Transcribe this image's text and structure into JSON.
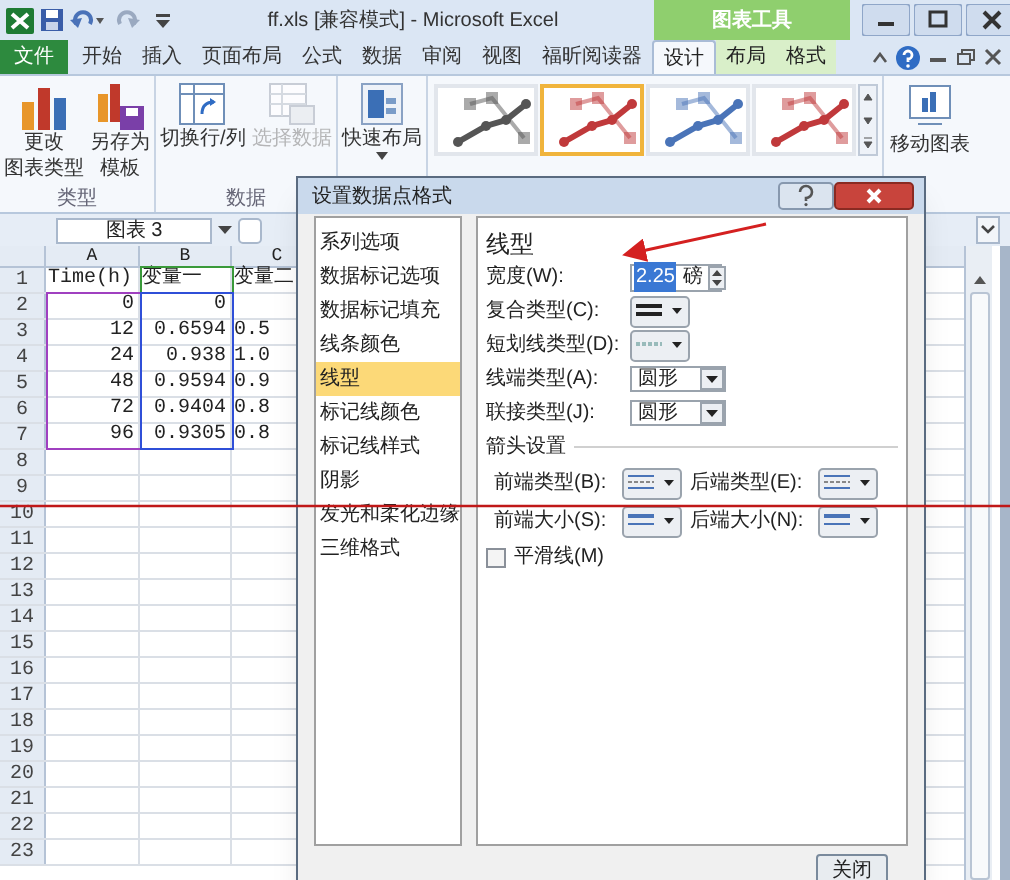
{
  "window": {
    "title": "ff.xls [兼容模式] - Microsoft Excel",
    "context_title": "图表工具"
  },
  "tabs": [
    {
      "label": "文件",
      "kind": "file",
      "selected": false
    },
    {
      "label": "开始",
      "kind": "tab",
      "selected": false
    },
    {
      "label": "插入",
      "kind": "tab",
      "selected": false
    },
    {
      "label": "页面布局",
      "kind": "tab",
      "selected": false
    },
    {
      "label": "公式",
      "kind": "tab",
      "selected": false
    },
    {
      "label": "数据",
      "kind": "tab",
      "selected": false
    },
    {
      "label": "审阅",
      "kind": "tab",
      "selected": false
    },
    {
      "label": "视图",
      "kind": "tab",
      "selected": false
    },
    {
      "label": "福昕阅读器",
      "kind": "tab",
      "selected": false
    },
    {
      "label": "设计",
      "kind": "context",
      "selected": true
    },
    {
      "label": "布局",
      "kind": "context",
      "selected": false
    },
    {
      "label": "格式",
      "kind": "context",
      "selected": false
    }
  ],
  "ribbon": {
    "groups": [
      {
        "label": "类型",
        "buttons": [
          {
            "lines": [
              "更改",
              "图表类型"
            ],
            "kind": "charttype",
            "disabled": false
          },
          {
            "lines": [
              "另存为",
              "模板"
            ],
            "kind": "template",
            "disabled": false
          }
        ]
      },
      {
        "label": "数据",
        "buttons": [
          {
            "lines": [
              "切换行/列"
            ],
            "kind": "switch",
            "disabled": false
          },
          {
            "lines": [
              "选择数据"
            ],
            "kind": "select",
            "disabled": true
          }
        ]
      }
    ],
    "layout_button": {
      "label": "快速布局"
    },
    "styles": [
      {
        "color": "#555555",
        "selected": false
      },
      {
        "color": "#c0393b",
        "selected": true
      },
      {
        "color": "#4a74b8",
        "selected": false
      },
      {
        "color": "#c0393b",
        "selected": false
      }
    ],
    "move_button": {
      "label": "移动图表"
    }
  },
  "name_box": {
    "value": "图表 3"
  },
  "sheet": {
    "columns": [
      {
        "label": "A",
        "color": "#a040c0"
      },
      {
        "label": "B",
        "color": "#2f4fd8",
        "header_range": {
          "color": "#3a9a3a"
        }
      },
      {
        "label": "C"
      }
    ],
    "rows": [
      {
        "label": "1",
        "cells": [
          "Time(h)",
          "变量一",
          "变量二"
        ]
      },
      {
        "label": "2",
        "cells": [
          "0",
          "0"
        ]
      },
      {
        "label": "3",
        "cells": [
          "12",
          "0.6594",
          "0.5"
        ]
      },
      {
        "label": "4",
        "cells": [
          "24",
          "0.938",
          "1.0"
        ]
      },
      {
        "label": "5",
        "cells": [
          "48",
          "0.9594",
          "0.9"
        ]
      },
      {
        "label": "6",
        "cells": [
          "72",
          "0.9404",
          "0.8"
        ]
      },
      {
        "label": "7",
        "cells": [
          "96",
          "0.9305",
          "0.8"
        ]
      },
      {
        "label": "8"
      },
      {
        "label": "9"
      },
      {
        "label": "10"
      },
      {
        "label": "11"
      },
      {
        "label": "12"
      },
      {
        "label": "13"
      },
      {
        "label": "14"
      },
      {
        "label": "15"
      },
      {
        "label": "16"
      },
      {
        "label": "17"
      },
      {
        "label": "18"
      },
      {
        "label": "19"
      },
      {
        "label": "20"
      },
      {
        "label": "21"
      },
      {
        "label": "22"
      },
      {
        "label": "23"
      }
    ]
  },
  "dialog": {
    "title": "设置数据点格式",
    "nav": [
      {
        "label": "系列选项",
        "selected": false
      },
      {
        "label": "数据标记选项",
        "selected": false
      },
      {
        "label": "数据标记填充",
        "selected": false
      },
      {
        "label": "线条颜色",
        "selected": false
      },
      {
        "label": "线型",
        "selected": true
      },
      {
        "label": "标记线颜色",
        "selected": false
      },
      {
        "label": "标记线样式",
        "selected": false
      },
      {
        "label": "阴影",
        "selected": false
      },
      {
        "label": "发光和柔化边缘",
        "selected": false
      },
      {
        "label": "三维格式",
        "selected": false
      }
    ],
    "heading": "线型",
    "fields": [
      {
        "kind": "spin",
        "label": "宽度(W):",
        "value": "2.25",
        "unit": "磅",
        "text_selected": true
      },
      {
        "kind": "compound",
        "label": "复合类型(C):"
      },
      {
        "kind": "dash",
        "label": "短划线类型(D):"
      },
      {
        "kind": "select",
        "label": "线端类型(A):",
        "value": "圆形"
      },
      {
        "kind": "select",
        "label": "联接类型(J):",
        "value": "圆形"
      },
      {
        "kind": "section",
        "label": "箭头设置"
      },
      {
        "kind": "arrowtype",
        "pair": [
          {
            "label": "前端类型(B):"
          },
          {
            "label": "后端类型(E):"
          }
        ]
      },
      {
        "kind": "arrowsize",
        "pair": [
          {
            "label": "前端大小(S):"
          },
          {
            "label": "后端大小(N):"
          }
        ]
      },
      {
        "kind": "checkbox",
        "label": "平滑线(M)",
        "checked": false
      }
    ],
    "close_button": "关闭"
  }
}
